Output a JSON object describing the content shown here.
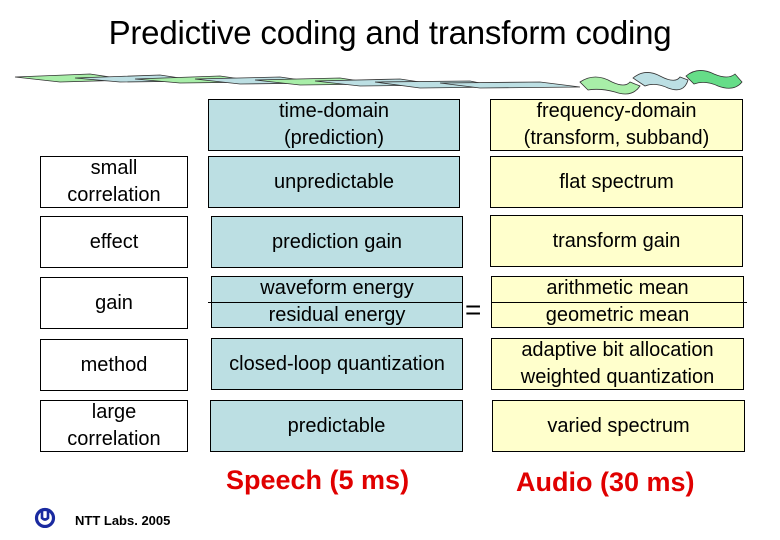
{
  "title": "Predictive coding and transform coding",
  "columns": {
    "time": {
      "line1": "time-domain",
      "line2": "(prediction)"
    },
    "freq": {
      "line1": "frequency-domain",
      "line2": "(transform, subband)"
    }
  },
  "rows": [
    {
      "label": [
        "small",
        "correlation"
      ],
      "time": [
        "unpredictable"
      ],
      "freq": [
        "flat spectrum"
      ]
    },
    {
      "label": [
        "effect"
      ],
      "time": [
        "prediction gain"
      ],
      "freq": [
        "transform gain"
      ]
    },
    {
      "label": [
        "gain"
      ],
      "time": [
        "waveform energy",
        "residual energy"
      ],
      "freq": [
        "arithmetic mean",
        "geometric mean"
      ]
    },
    {
      "label": [
        "method"
      ],
      "time": [
        "closed-loop quantization"
      ],
      "freq": [
        "adaptive bit allocation",
        "weighted quantization"
      ]
    },
    {
      "label": [
        "large",
        "correlation"
      ],
      "time": [
        "predictable"
      ],
      "freq": [
        "varied spectrum"
      ]
    }
  ],
  "equals_sign": "=",
  "bottom": {
    "speech": "Speech (5 ms)",
    "audio": "Audio (30 ms)"
  },
  "footer": "NTT Labs. 2005",
  "colors": {
    "time_box": "#bcdfe3",
    "freq_box": "#ffffcc",
    "highlight_red": "#e00000",
    "logo_blue": "#1a2aa0"
  }
}
